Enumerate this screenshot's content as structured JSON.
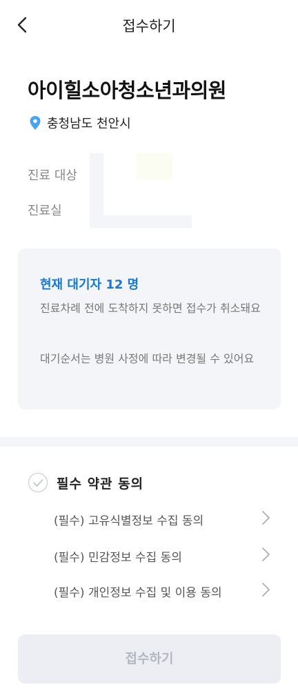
{
  "header": {
    "title": "접수하기"
  },
  "clinic": {
    "name": "아이힐소아청소년과의원",
    "location": "충청남도 천안시"
  },
  "info": {
    "patient_label": "진료 대상",
    "room_label": "진료실"
  },
  "notice": {
    "waiting_title": "현재 대기자 12 명",
    "line1": "진료차례 전에 도착하지 못하면 접수가 취소돼요",
    "line2": "대기순서는 병원 사정에 따라 변경될 수 있어요"
  },
  "terms": {
    "all_label": "필수 약관 동의",
    "items": [
      {
        "label": "(필수) 고유식별정보 수집 동의"
      },
      {
        "label": "(필수) 민감정보 수집 동의"
      },
      {
        "label": "(필수) 개인정보 수집 및 이용 동의"
      }
    ]
  },
  "submit": {
    "label": "접수하기"
  },
  "colors": {
    "accent": "#1578d6",
    "pin": "#4aa3f0",
    "disabled_bg": "#eceef3",
    "disabled_text": "#b4b8c0"
  }
}
